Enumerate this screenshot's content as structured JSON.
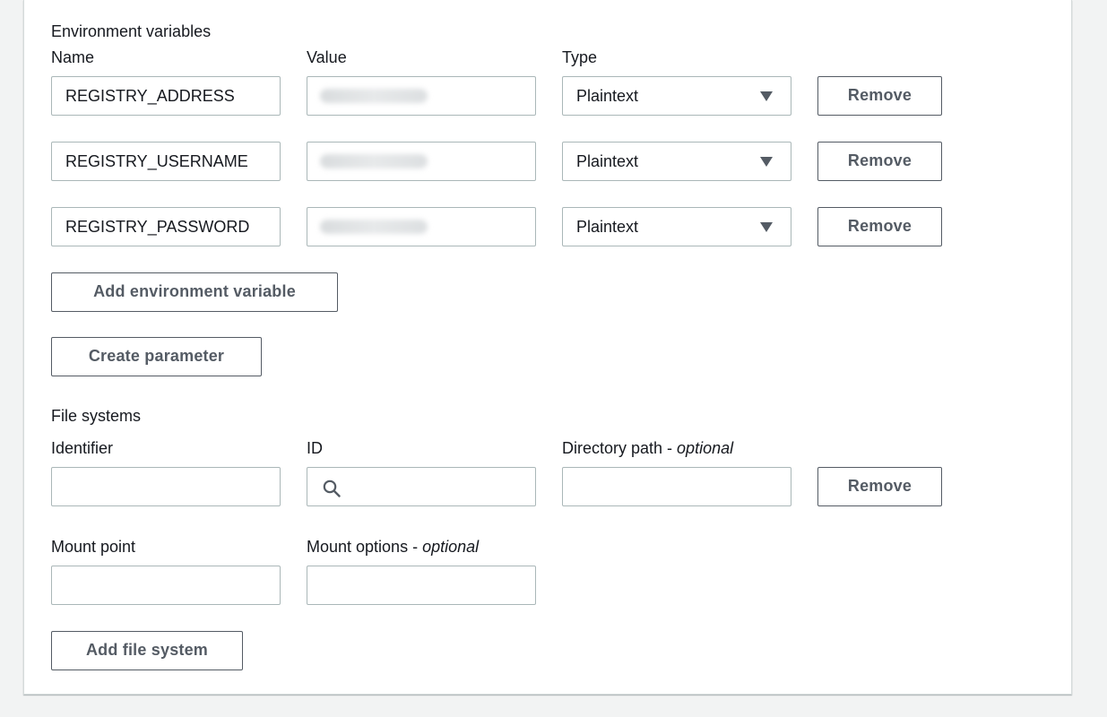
{
  "env": {
    "section_title": "Environment variables",
    "col_name": "Name",
    "col_value": "Value",
    "col_type": "Type",
    "rows": [
      {
        "name": "REGISTRY_ADDRESS",
        "value": "",
        "type": "Plaintext",
        "remove": "Remove"
      },
      {
        "name": "REGISTRY_USERNAME",
        "value": "",
        "type": "Plaintext",
        "remove": "Remove"
      },
      {
        "name": "REGISTRY_PASSWORD",
        "value": "",
        "type": "Plaintext",
        "remove": "Remove"
      }
    ],
    "add_button": "Add environment variable",
    "create_param_button": "Create parameter"
  },
  "fs": {
    "section_title": "File systems",
    "col_identifier": "Identifier",
    "col_id": "ID",
    "col_dir_path": "Directory path - ",
    "col_dir_path_optional": "optional",
    "remove": "Remove",
    "mount_point": "Mount point",
    "mount_options": "Mount options - ",
    "mount_options_optional": "optional",
    "add_button": "Add file system"
  },
  "icons": {
    "dropdown": "caret-down-icon",
    "search": "search-icon"
  },
  "colors": {
    "border": "#aab7b8",
    "button_text": "#545b64",
    "background": "#f2f3f3"
  }
}
